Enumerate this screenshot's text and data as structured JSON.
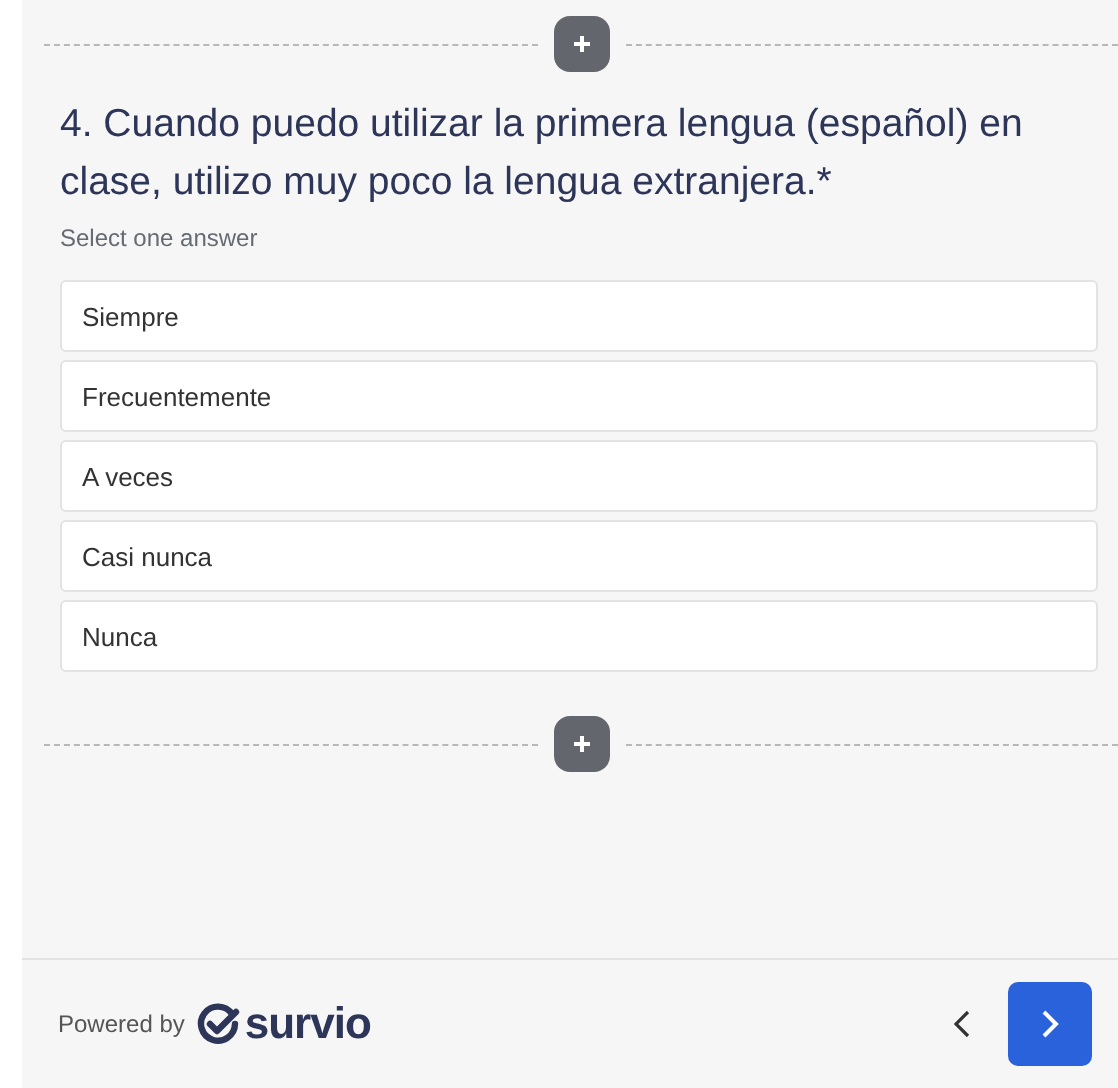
{
  "question": {
    "title": "4. Cuando puedo utilizar la primera lengua (español) en clase, utilizo muy poco la lengua extranjera.*",
    "hint": "Select one answer"
  },
  "options": [
    {
      "label": "Siempre",
      "selected": false
    },
    {
      "label": "Frecuentemente",
      "selected": false
    },
    {
      "label": "A veces",
      "selected": false
    },
    {
      "label": "Casi nunca",
      "selected": false
    },
    {
      "label": "Nunca",
      "selected": false
    }
  ],
  "footer": {
    "powered_by": "Powered by",
    "brand": "survio"
  }
}
